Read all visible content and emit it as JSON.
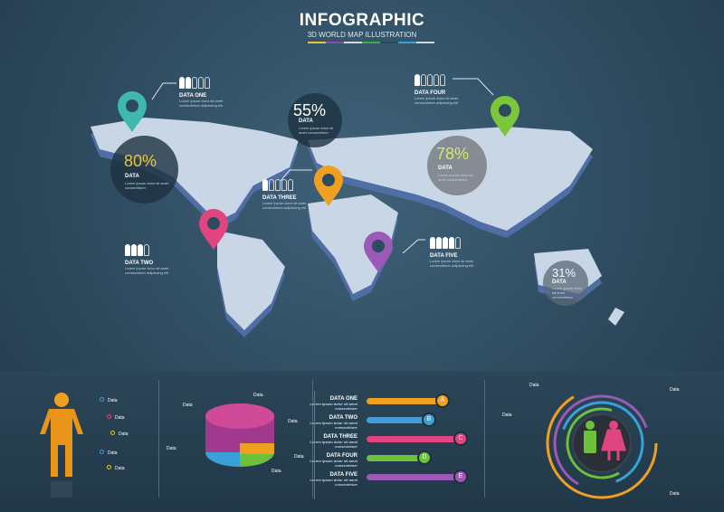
{
  "header": {
    "title": "INFOGRAPHIC",
    "subtitle": "3D WORLD MAP ILLUSTRATION",
    "stripe_colors": [
      "#e7c53a",
      "#8c4bb0",
      "#cfd9de",
      "#3faa4a",
      "#2b4a5e",
      "#3aa0d8",
      "#cfd9de"
    ]
  },
  "map": {
    "stats": [
      {
        "value": "80%",
        "label": "DATA",
        "lorem": "Lorem ipsum dolor sit amet consectetuer",
        "color": "#e8c53a"
      },
      {
        "value": "55%",
        "label": "DATA",
        "lorem": "Lorem ipsum dolor sit amet consectetuer",
        "color": "#dfe8ee"
      },
      {
        "value": "78%",
        "label": "DATA",
        "lorem": "Lorem ipsum dolor sit amet consectetuer",
        "color": "#d6e66a"
      },
      {
        "value": "31%",
        "label": "DATA",
        "lorem": "Lorem ipsum dolor sit amet consectetuer",
        "color": "#dfe8ee"
      }
    ],
    "callouts": [
      {
        "label": "DATA ONE",
        "lorem": "Lorem ipsum dolor sit amet consectetuer adipiscing elit",
        "filled": 2,
        "total": 5
      },
      {
        "label": "DATA TWO",
        "lorem": "Lorem ipsum dolor sit amet consectetuer adipiscing elit",
        "filled": 3,
        "total": 4
      },
      {
        "label": "DATA THREE",
        "lorem": "Lorem ipsum dolor sit amet consectetuer adipiscing elit",
        "filled": 1,
        "total": 5
      },
      {
        "label": "DATA FOUR",
        "lorem": "Lorem ipsum dolor sit amet consectetuer adipiscing elit",
        "filled": 1,
        "total": 5
      },
      {
        "label": "DATA FIVE",
        "lorem": "Lorem ipsum dolor sit amet consectetuer adipiscing elit",
        "filled": 4,
        "total": 5
      }
    ],
    "pins": [
      {
        "name": "north-america",
        "color": "#3fb8b0"
      },
      {
        "name": "europe",
        "color": "#f0a020"
      },
      {
        "name": "south-america",
        "color": "#e0457f"
      },
      {
        "name": "africa",
        "color": "#9a5ab5"
      },
      {
        "name": "asia",
        "color": "#7cc63a"
      }
    ]
  },
  "person_panel": {
    "labels": [
      "Data",
      "Data",
      "Data",
      "Data",
      "Data"
    ],
    "dot_colors": [
      "#3aa0d8",
      "#e0457f",
      "#e8c53a",
      "#3aa0d8",
      "#e8c53a"
    ]
  },
  "pie_panel": {
    "labels": [
      "Data",
      "Data",
      "Data",
      "Data",
      "Data",
      "Data"
    ]
  },
  "bars_panel": {
    "items": [
      {
        "label": "DATA ONE",
        "lorem": "Lorem ipsum dolor sit amet consectetuer",
        "letter": "A",
        "value": 0.8,
        "color": "#f0a020"
      },
      {
        "label": "DATA TWO",
        "lorem": "Lorem ipsum dolor sit amet consectetuer",
        "letter": "B",
        "value": 0.65,
        "color": "#3aa0d8"
      },
      {
        "label": "DATA THREE",
        "lorem": "Lorem ipsum dolor sit amet consectetuer",
        "letter": "C",
        "value": 1.0,
        "color": "#e0457f"
      },
      {
        "label": "DATA FOUR",
        "lorem": "Lorem ipsum dolor sit amet consectetuer",
        "letter": "D",
        "value": 0.6,
        "color": "#6cc03a"
      },
      {
        "label": "DATA FIVE",
        "lorem": "Lorem ipsum dolor sit amet consectetuer",
        "letter": "E",
        "value": 1.0,
        "color": "#9a5ab5"
      }
    ]
  },
  "ring_panel": {
    "labels": [
      "Data",
      "Data",
      "Data",
      "Data"
    ]
  }
}
